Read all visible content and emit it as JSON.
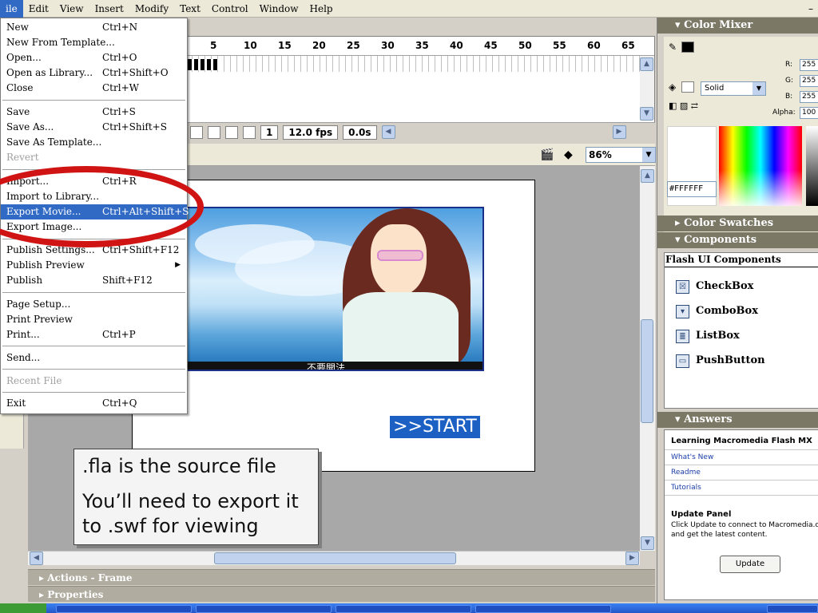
{
  "menubar": {
    "items": [
      "ile",
      "Edit",
      "View",
      "Insert",
      "Modify",
      "Text",
      "Control",
      "Window",
      "Help"
    ],
    "minimize": "–"
  },
  "file_menu": {
    "rows": [
      {
        "label": "New",
        "shortcut": "Ctrl+N"
      },
      {
        "label": "New From Template...",
        "shortcut": ""
      },
      {
        "label": "Open...",
        "shortcut": "Ctrl+O"
      },
      {
        "label": "Open as Library...",
        "shortcut": "Ctrl+Shift+O"
      },
      {
        "label": "Close",
        "shortcut": "Ctrl+W"
      },
      {
        "label": "Save",
        "shortcut": "Ctrl+S"
      },
      {
        "label": "Save As...",
        "shortcut": "Ctrl+Shift+S"
      },
      {
        "label": "Save As Template...",
        "shortcut": ""
      },
      {
        "label": "Revert",
        "shortcut": ""
      },
      {
        "label": "Import...",
        "shortcut": "Ctrl+R"
      },
      {
        "label": "Import to Library...",
        "shortcut": ""
      },
      {
        "label": "Export Movie...",
        "shortcut": "Ctrl+Alt+Shift+S"
      },
      {
        "label": "Export Image...",
        "shortcut": ""
      },
      {
        "label": "Publish Settings...",
        "shortcut": "Ctrl+Shift+F12"
      },
      {
        "label": "Publish Preview",
        "shortcut": ""
      },
      {
        "label": "Publish",
        "shortcut": "Shift+F12"
      },
      {
        "label": "Page Setup...",
        "shortcut": ""
      },
      {
        "label": "Print Preview",
        "shortcut": ""
      },
      {
        "label": "Print...",
        "shortcut": "Ctrl+P"
      },
      {
        "label": "Send...",
        "shortcut": ""
      },
      {
        "label": "Recent File",
        "shortcut": ""
      },
      {
        "label": "Exit",
        "shortcut": "Ctrl+Q"
      }
    ]
  },
  "timeline": {
    "ruler": [
      "5",
      "10",
      "15",
      "20",
      "25",
      "30",
      "35",
      "40",
      "45",
      "50",
      "55",
      "60",
      "65"
    ],
    "current_frame": "1",
    "frame_rate": "12.0 fps",
    "elapsed": "0.0s"
  },
  "stage": {
    "zoom": "86%",
    "start_button": ">>START",
    "caption": "不要開法"
  },
  "callout": {
    "line1": ".fla is the source file",
    "line2": "You’ll need to export it to .swf for viewing"
  },
  "bottom_panels": {
    "actions": "Actions - Frame",
    "properties": "Properties"
  },
  "color_mixer": {
    "title": "Color Mixer",
    "fill_type": "Solid",
    "r_label": "R:",
    "g_label": "G:",
    "b_label": "B:",
    "alpha_label": "Alpha:",
    "r": "255",
    "g": "255",
    "b": "255",
    "alpha": "100",
    "hex": "#FFFFFF"
  },
  "color_swatches": {
    "title": "Color Swatches"
  },
  "components": {
    "title": "Components",
    "set": "Flash UI Components",
    "items": [
      "CheckBox",
      "ComboBox",
      "ListBox",
      "PushButton"
    ]
  },
  "answers": {
    "title": "Answers",
    "heading": "Learning Macromedia Flash MX",
    "links": [
      "What's New",
      "Readme",
      "Tutorials"
    ],
    "update_heading": "Update Panel",
    "update_desc": "Click Update to connect to Macromedia.c and get the latest content.",
    "update_button": "Update"
  },
  "colors": {
    "menu_highlight": "#316ac5",
    "annotation_ring": "#d01414",
    "start_button": "#1d60c4",
    "panel_header": "#7c7866"
  }
}
